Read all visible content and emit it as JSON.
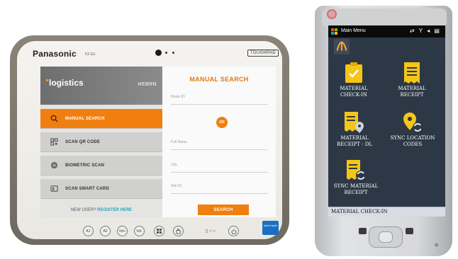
{
  "tablet": {
    "brand": "Panasonic",
    "model": "FZ-G1",
    "badge": "TOUGHPAD",
    "app": {
      "logo_text": "logistics",
      "language": "HEBRN",
      "menu": [
        {
          "label": "MANUAL SEARCH",
          "icon": "search-icon",
          "active": true
        },
        {
          "label": "SCAN QR CODE",
          "icon": "qr-code-icon",
          "active": false
        },
        {
          "label": "BIOMETRIC SCAN",
          "icon": "fingerprint-icon",
          "active": false
        },
        {
          "label": "SCAN SMART CARD",
          "icon": "smart-card-icon",
          "active": false
        }
      ],
      "new_user_prefix": "NEW USER?",
      "register_link": "REGISTER HERE",
      "manual_search": {
        "title": "MANUAL SEARCH",
        "fields": [
          "Route ID",
          "Full Name",
          "City",
          "Site ID"
        ],
        "or_label": "OR",
        "search_button": "SEARCH"
      }
    },
    "hardware_buttons": [
      "A1",
      "A2",
      "Vol+",
      "Vol-",
      "win",
      "rot"
    ],
    "leds": "▯ ○ ○",
    "intel_label": "intel inside"
  },
  "handheld": {
    "status_title": "Main Menu",
    "status_icons": "⇄ Y ◂ ▤",
    "menu_tiles": [
      {
        "label_line1": "MATERIAL",
        "label_line2": "CHECK-IN",
        "icon": "clipboard-check-icon"
      },
      {
        "label_line1": "MATERIAL",
        "label_line2": "RECEIPT",
        "icon": "receipt-icon"
      },
      {
        "label_line1": "MATERIAL",
        "label_line2": "RECEIPT - DL",
        "icon": "receipt-location-icon"
      },
      {
        "label_line1": "SYNC LOCATION",
        "label_line2": "CODES",
        "icon": "sync-location-icon"
      },
      {
        "label_line1": "SYNC MATERIAL",
        "label_line2": "RECEIPT",
        "icon": "sync-receipt-icon"
      }
    ],
    "selected_item": "MATERIAL CHECK-IN",
    "colors": {
      "accent": "#f07f0f",
      "tile_yellow": "#f5c518",
      "screen_bg": "#2d3846"
    }
  }
}
